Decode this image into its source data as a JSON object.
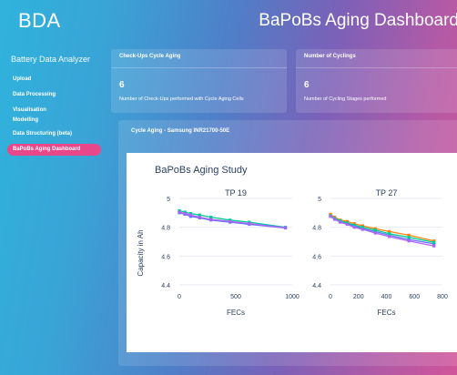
{
  "header": {
    "brand": "BDA",
    "title": "BaPoBs Aging Dashboard"
  },
  "sidebar": {
    "title": "Battery Data Analyzer",
    "items": [
      {
        "label": "Upload",
        "active": false
      },
      {
        "label": "Data Processing",
        "active": false
      },
      {
        "label": "Visualisation",
        "active": false
      },
      {
        "label": "Modelling",
        "active": false
      },
      {
        "label": "Data Structuring (beta)",
        "active": false
      },
      {
        "label": "BaPoBs Aging Dashboard",
        "active": true
      }
    ]
  },
  "cards": [
    {
      "title": "Check-Ups Cycle Aging",
      "value": "6",
      "desc": "Number of Check-Ups performed with Cycle Aging Cells"
    },
    {
      "title": "Number of Cyclings",
      "value": "6",
      "desc": "Number of Cycling Stages performed"
    }
  ],
  "panel": {
    "title": "Cycle Aging - Samsung INR21700-50E"
  },
  "colors": {
    "accent": "#e8488a"
  },
  "chart_data": {
    "type": "line",
    "title": "BaPoBs Aging Study",
    "ylabel": "Capacity in Ah",
    "ylim": [
      4.4,
      5.0
    ],
    "yticks": [
      "5",
      "4.8",
      "4.6",
      "4.4"
    ],
    "subplots": [
      {
        "title": "TP 19",
        "xlabel": "FECs",
        "xlim": [
          0,
          1000
        ],
        "xticks": [
          "0",
          "500",
          "1000"
        ],
        "series": [
          {
            "color": "#636efa",
            "x": [
              0,
              50,
              100,
              180,
              280,
              450,
              620,
              940
            ],
            "y": [
              4.9,
              4.89,
              4.875,
              4.865,
              4.85,
              4.835,
              4.82,
              4.795
            ]
          },
          {
            "color": "#00cc96",
            "x": [
              0,
              50,
              100,
              180,
              280,
              450,
              620,
              940
            ],
            "y": [
              4.915,
              4.905,
              4.895,
              4.885,
              4.87,
              4.85,
              4.835,
              4.8
            ]
          },
          {
            "color": "#ab63fa",
            "x": [
              0,
              50,
              100,
              180,
              280,
              450,
              620,
              940
            ],
            "y": [
              4.905,
              4.895,
              4.885,
              4.87,
              4.855,
              4.84,
              4.825,
              4.797
            ]
          }
        ]
      },
      {
        "title": "TP 27",
        "xlabel": "FECs",
        "xlim": [
          0,
          800
        ],
        "xticks": [
          "0",
          "200",
          "400",
          "600",
          "800"
        ],
        "series": [
          {
            "color": "#636efa",
            "x": [
              0,
              30,
              70,
              120,
              170,
              230,
              320,
              420,
              560,
              740
            ],
            "y": [
              4.885,
              4.86,
              4.84,
              4.825,
              4.81,
              4.79,
              4.77,
              4.745,
              4.715,
              4.685
            ]
          },
          {
            "color": "#ff7f0e",
            "x": [
              0,
              30,
              70,
              120,
              170,
              230,
              320,
              420,
              560,
              740
            ],
            "y": [
              4.89,
              4.87,
              4.85,
              4.84,
              4.825,
              4.81,
              4.79,
              4.77,
              4.745,
              4.705
            ]
          },
          {
            "color": "#00cc96",
            "x": [
              0,
              30,
              70,
              120,
              170,
              230,
              320,
              420,
              560,
              740
            ],
            "y": [
              4.88,
              4.862,
              4.845,
              4.83,
              4.815,
              4.8,
              4.78,
              4.755,
              4.73,
              4.695
            ]
          },
          {
            "color": "#ab63fa",
            "x": [
              0,
              30,
              70,
              120,
              170,
              230,
              320,
              420,
              560,
              740
            ],
            "y": [
              4.875,
              4.855,
              4.835,
              4.82,
              4.8,
              4.785,
              4.76,
              4.735,
              4.705,
              4.67
            ]
          }
        ]
      }
    ]
  }
}
